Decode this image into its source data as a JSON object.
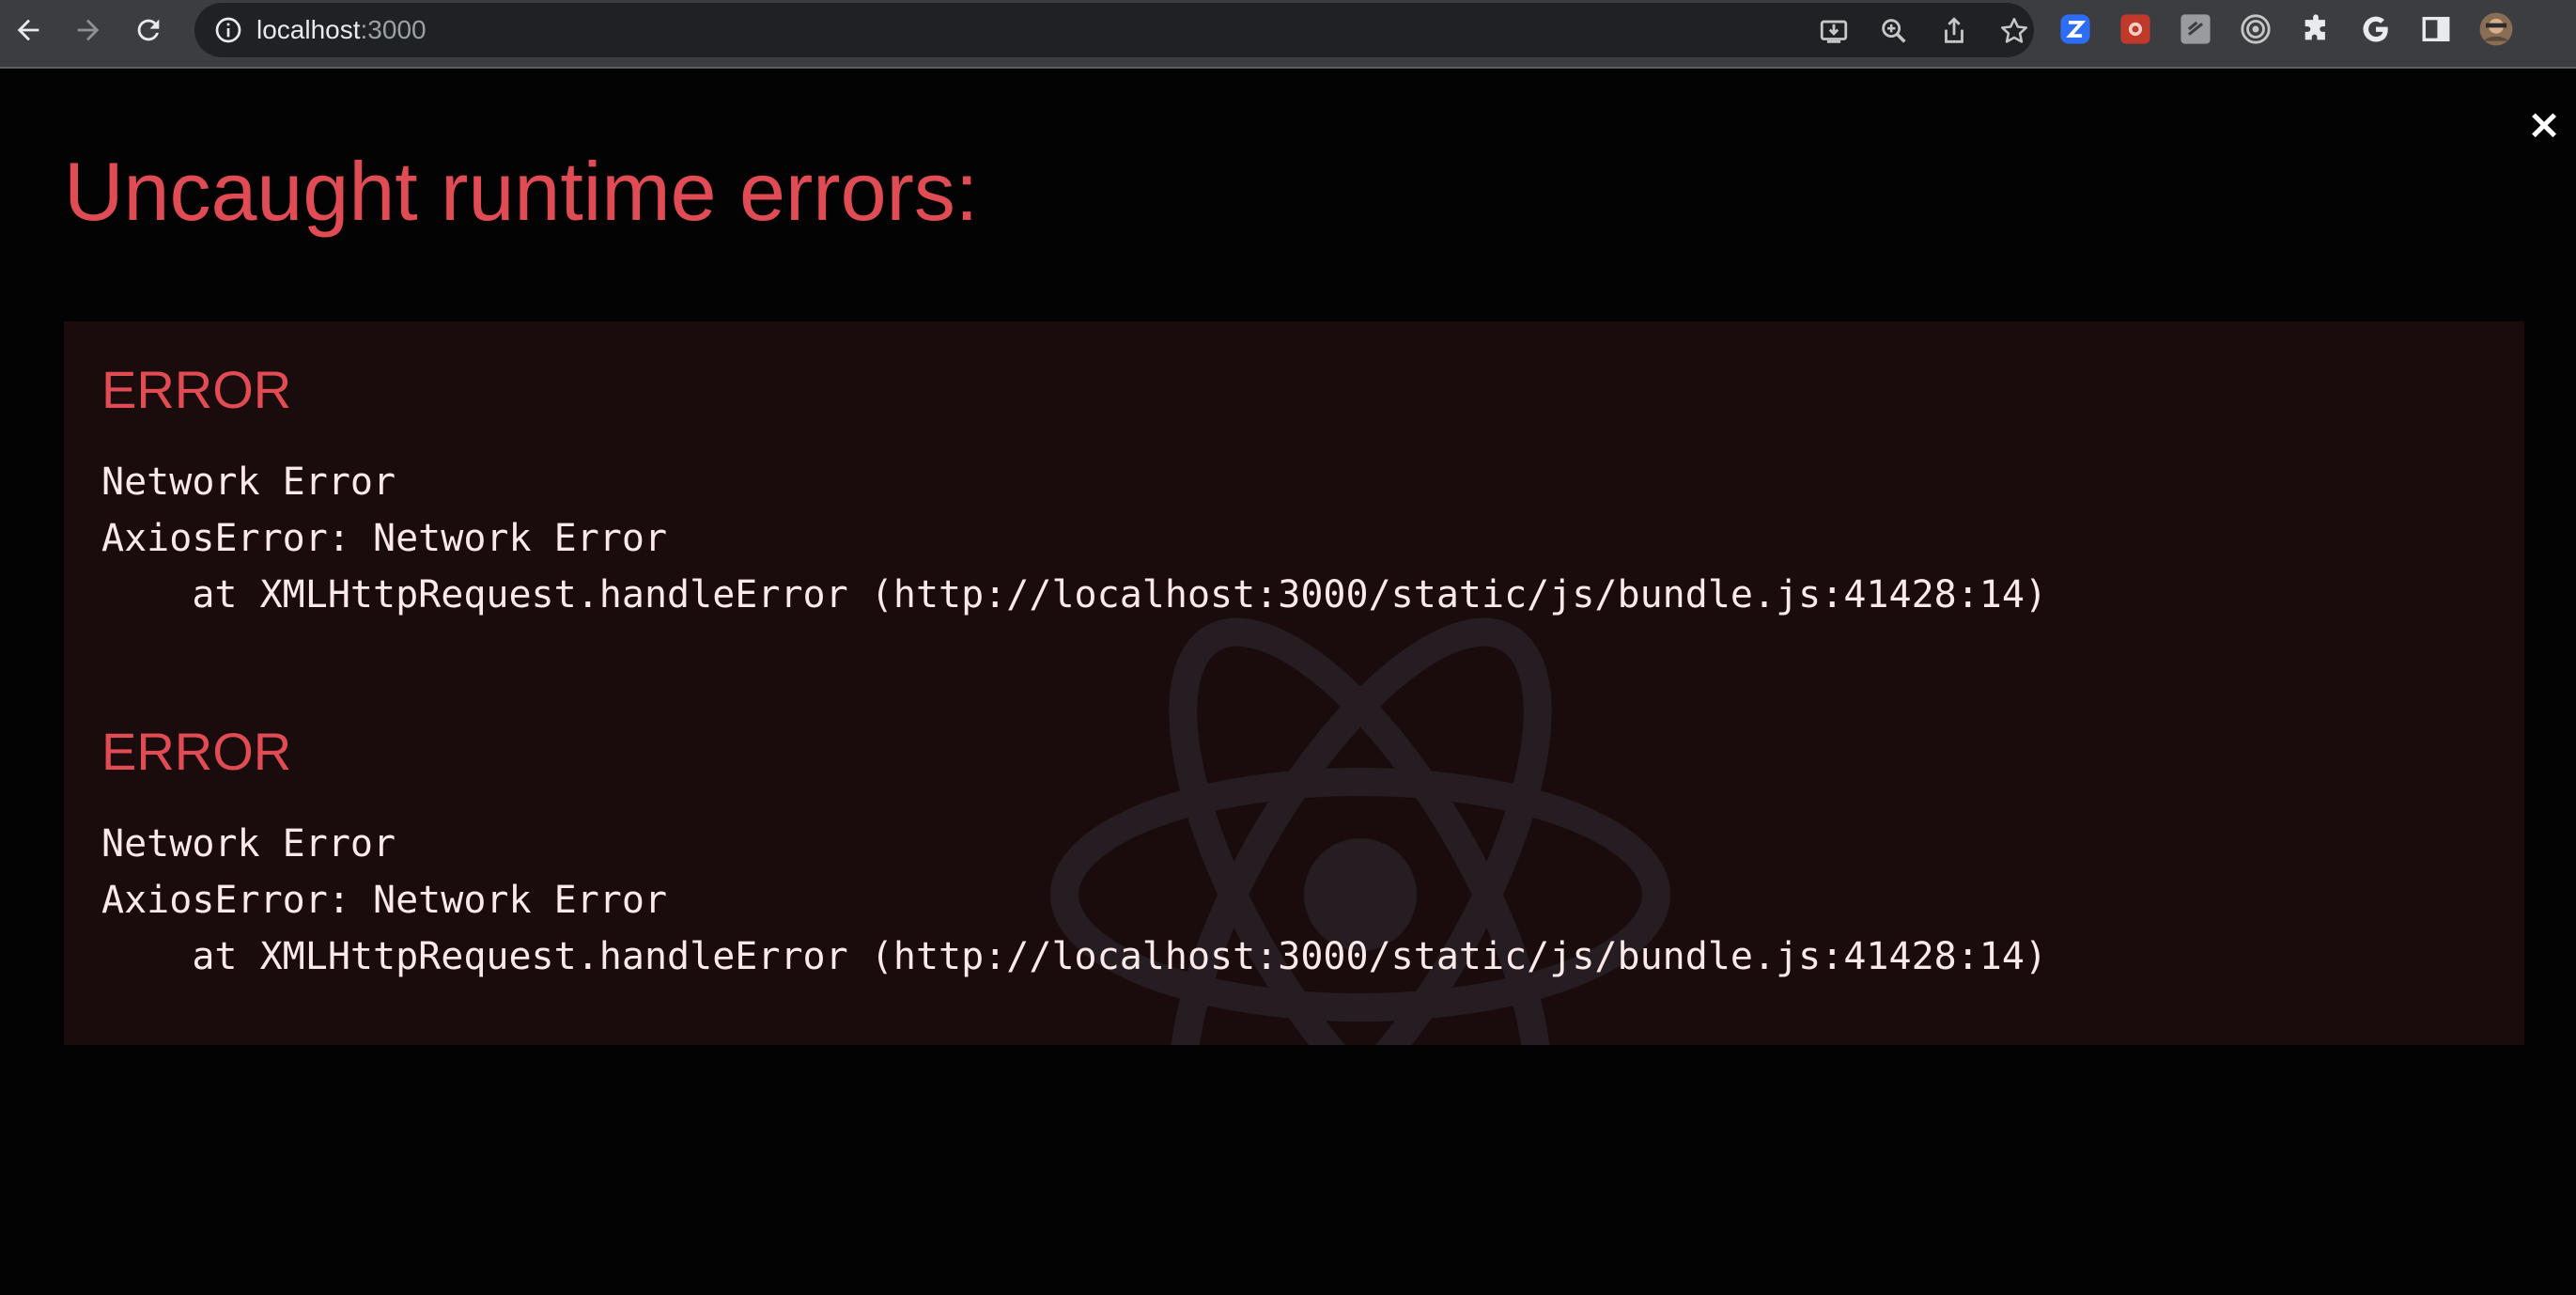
{
  "browser": {
    "url_host": "localhost",
    "url_port": ":3000",
    "toolbar_icons": [
      "back-icon",
      "forward-icon",
      "reload-icon",
      "site-info-icon",
      "install-app-icon",
      "zoom-icon",
      "share-icon",
      "bookmark-star-icon"
    ],
    "extension_icons": [
      "zoom-extension-icon",
      "red-extension-icon",
      "grey-extension-icon",
      "target-extension-icon",
      "puzzle-extensions-icon",
      "google-icon",
      "side-panel-icon",
      "profile-avatar"
    ]
  },
  "overlay": {
    "title": "Uncaught runtime errors:",
    "close_label": "×",
    "errors": [
      {
        "label": "ERROR",
        "line1": "Network Error",
        "line2": "AxiosError: Network Error",
        "line3": "    at XMLHttpRequest.handleError (http://localhost:3000/static/js/bundle.js:41428:14)"
      },
      {
        "label": "ERROR",
        "line1": "Network Error",
        "line2": "AxiosError: Network Error",
        "line3": "    at XMLHttpRequest.handleError (http://localhost:3000/static/js/bundle.js:41428:14)"
      }
    ]
  },
  "colors": {
    "error_red": "#e14b53",
    "panel_bg": "#1a0b0c",
    "page_bg": "#030303",
    "toolbar_bg": "#3c3d40"
  }
}
